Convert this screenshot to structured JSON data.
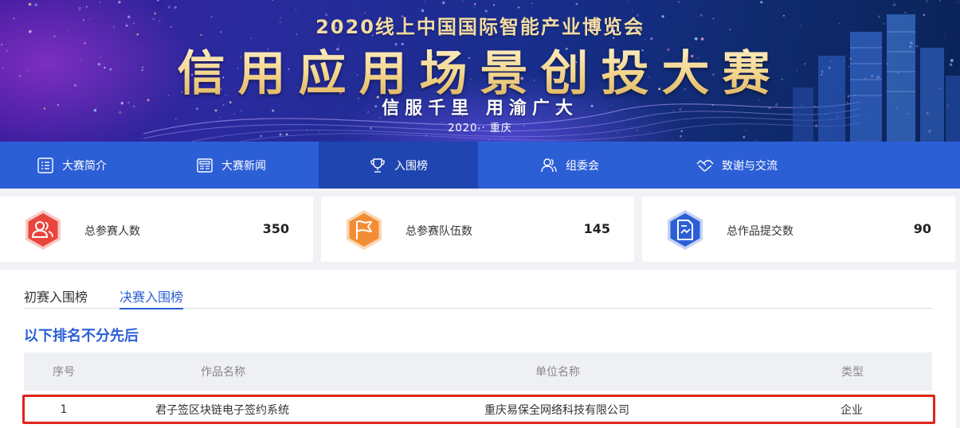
{
  "banner": {
    "subtitle": "2020线上中国国际智能产业博览会",
    "title": "信用应用场景创投大赛",
    "slogan": "信服千里 用渝广大",
    "date": "2020 · 重庆"
  },
  "nav": {
    "items": [
      {
        "label": "大赛简介",
        "icon": "list-icon",
        "active": false
      },
      {
        "label": "大赛新闻",
        "icon": "newspaper-icon",
        "active": false
      },
      {
        "label": "入围榜",
        "icon": "trophy-icon",
        "active": true
      },
      {
        "label": "组委会",
        "icon": "users-icon",
        "active": false
      },
      {
        "label": "致谢与交流",
        "icon": "handshake-icon",
        "active": false
      }
    ]
  },
  "stats": [
    {
      "label": "总参赛人数",
      "value": "350",
      "icon": "people-icon",
      "color": "#e8453c"
    },
    {
      "label": "总参赛队伍数",
      "value": "145",
      "icon": "flag-icon",
      "color": "#f38d35"
    },
    {
      "label": "总作品提交数",
      "value": "90",
      "icon": "document-icon",
      "color": "#2c5fd6"
    }
  ],
  "tabs": {
    "items": [
      {
        "label": "初赛入围榜",
        "active": false
      },
      {
        "label": "决赛入围榜",
        "active": true
      }
    ]
  },
  "note": "以下排名不分先后",
  "table": {
    "headers": [
      "序号",
      "作品名称",
      "单位名称",
      "类型"
    ],
    "rows": [
      [
        "1",
        "君子签区块链电子签约系统",
        "重庆易保全网络科技有限公司",
        "企业"
      ]
    ]
  },
  "colors": {
    "primary": "#2c5fd6",
    "nav_active": "#1f45b0",
    "highlight_border": "#e0241b"
  }
}
